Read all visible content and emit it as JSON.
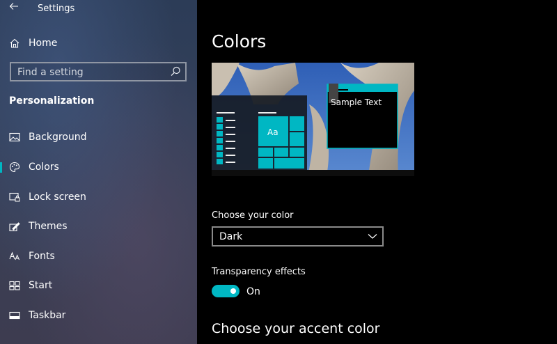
{
  "window": {
    "title": "Settings"
  },
  "sidebar": {
    "home_label": "Home",
    "search_placeholder": "Find a setting",
    "section_title": "Personalization",
    "items": [
      {
        "label": "Background",
        "icon": "image-icon",
        "selected": false
      },
      {
        "label": "Colors",
        "icon": "palette-icon",
        "selected": true
      },
      {
        "label": "Lock screen",
        "icon": "lock-screen-icon",
        "selected": false
      },
      {
        "label": "Themes",
        "icon": "brush-icon",
        "selected": false
      },
      {
        "label": "Fonts",
        "icon": "font-icon",
        "selected": false
      },
      {
        "label": "Start",
        "icon": "start-grid-icon",
        "selected": false
      },
      {
        "label": "Taskbar",
        "icon": "taskbar-icon",
        "selected": false
      }
    ]
  },
  "main": {
    "title": "Colors",
    "preview": {
      "sample_text": "Sample Text",
      "tile_text": "Aa"
    },
    "color_label": "Choose your color",
    "color_value": "Dark",
    "transparency_label": "Transparency effects",
    "transparency_state": "On",
    "accent_title": "Choose your accent color"
  },
  "colors": {
    "accent": "#00b7c3",
    "background": "#000000"
  }
}
